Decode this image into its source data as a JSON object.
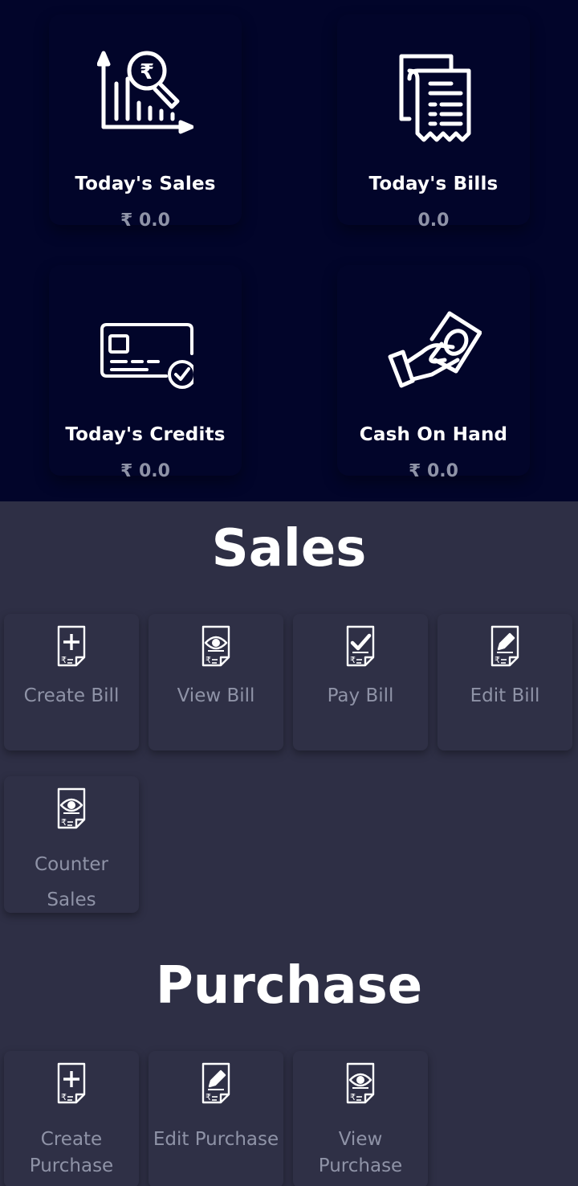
{
  "dashboard": {
    "cards": {
      "sales": {
        "label": "Today's Sales",
        "value": "₹ 0.0",
        "icon": "sales-chart-icon"
      },
      "bills": {
        "label": "Today's Bills",
        "value": "0.0",
        "icon": "receipt-icon"
      },
      "credits": {
        "label": "Today's Credits",
        "value": "₹ 0.0",
        "icon": "credit-card-check-icon"
      },
      "cash": {
        "label": "Cash On Hand",
        "value": "₹ 0.0",
        "icon": "hand-cash-icon"
      }
    }
  },
  "sales": {
    "title": "Sales",
    "tiles": {
      "create_bill": {
        "label": "Create Bill",
        "icon": "bill-plus-icon"
      },
      "view_bill": {
        "label": "View Bill",
        "icon": "bill-eye-icon"
      },
      "pay_bill": {
        "label": "Pay Bill",
        "icon": "bill-check-icon"
      },
      "edit_bill": {
        "label": "Edit Bill",
        "icon": "bill-pencil-icon"
      },
      "counter_sales": {
        "label": "Counter Sales",
        "icon": "bill-eye-icon"
      }
    }
  },
  "purchase": {
    "title": "Purchase",
    "tiles": {
      "create_purchase": {
        "label": "Create Purchase",
        "icon": "bill-plus-icon"
      },
      "edit_purchase": {
        "label": "Edit Purchase",
        "icon": "bill-pencil-icon"
      },
      "view_purchase": {
        "label": "View Purchase",
        "icon": "bill-eye-icon"
      }
    }
  },
  "colors": {
    "dashboard_bg": "#02052a",
    "page_bg": "#2e2f45",
    "tile_bg": "#2f3046",
    "value_text": "#8f93a7",
    "heading_text": "#ffffff"
  }
}
